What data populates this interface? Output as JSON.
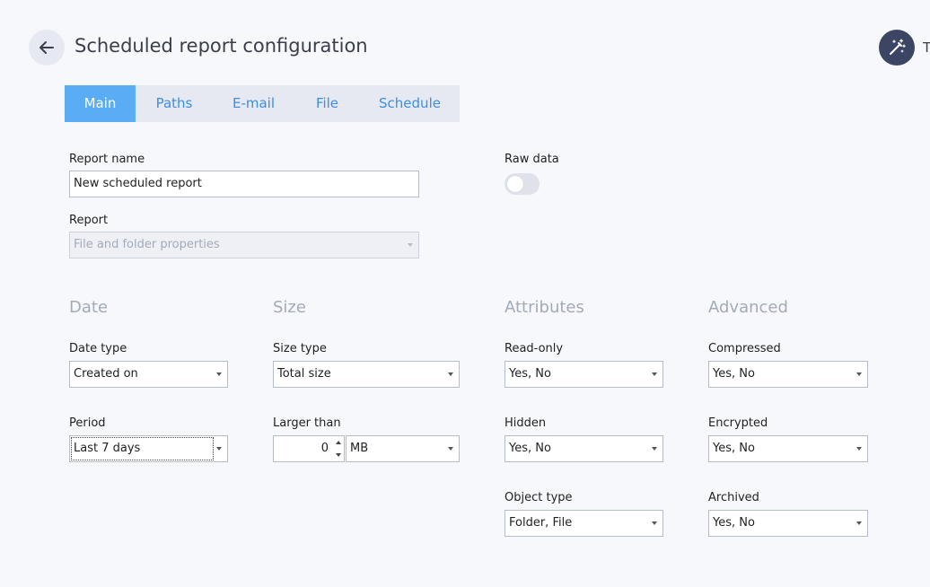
{
  "header": {
    "title": "Scheduled report configuration",
    "wand_label_partial": "T"
  },
  "tabs": [
    {
      "label": "Main",
      "active": true
    },
    {
      "label": "Paths",
      "active": false
    },
    {
      "label": "E-mail",
      "active": false
    },
    {
      "label": "File",
      "active": false
    },
    {
      "label": "Schedule",
      "active": false
    }
  ],
  "main": {
    "report_name_label": "Report name",
    "report_name_value": "New scheduled report",
    "report_label": "Report",
    "report_value": "File and folder properties",
    "raw_data_label": "Raw data",
    "raw_data_on": false
  },
  "sections": {
    "date": {
      "heading": "Date",
      "date_type_label": "Date type",
      "date_type_value": "Created on",
      "period_label": "Period",
      "period_value": "Last 7 days"
    },
    "size": {
      "heading": "Size",
      "size_type_label": "Size type",
      "size_type_value": "Total size",
      "larger_than_label": "Larger than",
      "larger_than_value": "0",
      "unit_value": "MB"
    },
    "attributes": {
      "heading": "Attributes",
      "read_only_label": "Read-only",
      "read_only_value": "Yes, No",
      "hidden_label": "Hidden",
      "hidden_value": "Yes, No",
      "object_type_label": "Object type",
      "object_type_value": "Folder, File"
    },
    "advanced": {
      "heading": "Advanced",
      "compressed_label": "Compressed",
      "compressed_value": "Yes, No",
      "encrypted_label": "Encrypted",
      "encrypted_value": "Yes, No",
      "archived_label": "Archived",
      "archived_value": "Yes, No"
    }
  },
  "icons": {
    "back": "arrow-left-icon",
    "wand": "magic-wand-icon",
    "dropdown": "caret-down-icon"
  },
  "colors": {
    "accent": "#5aadf2",
    "tab_text": "#3a8ee6",
    "tabbar_bg": "#e6e9f2",
    "wand_bg": "#3c4564",
    "section_heading": "#a3aab8"
  }
}
